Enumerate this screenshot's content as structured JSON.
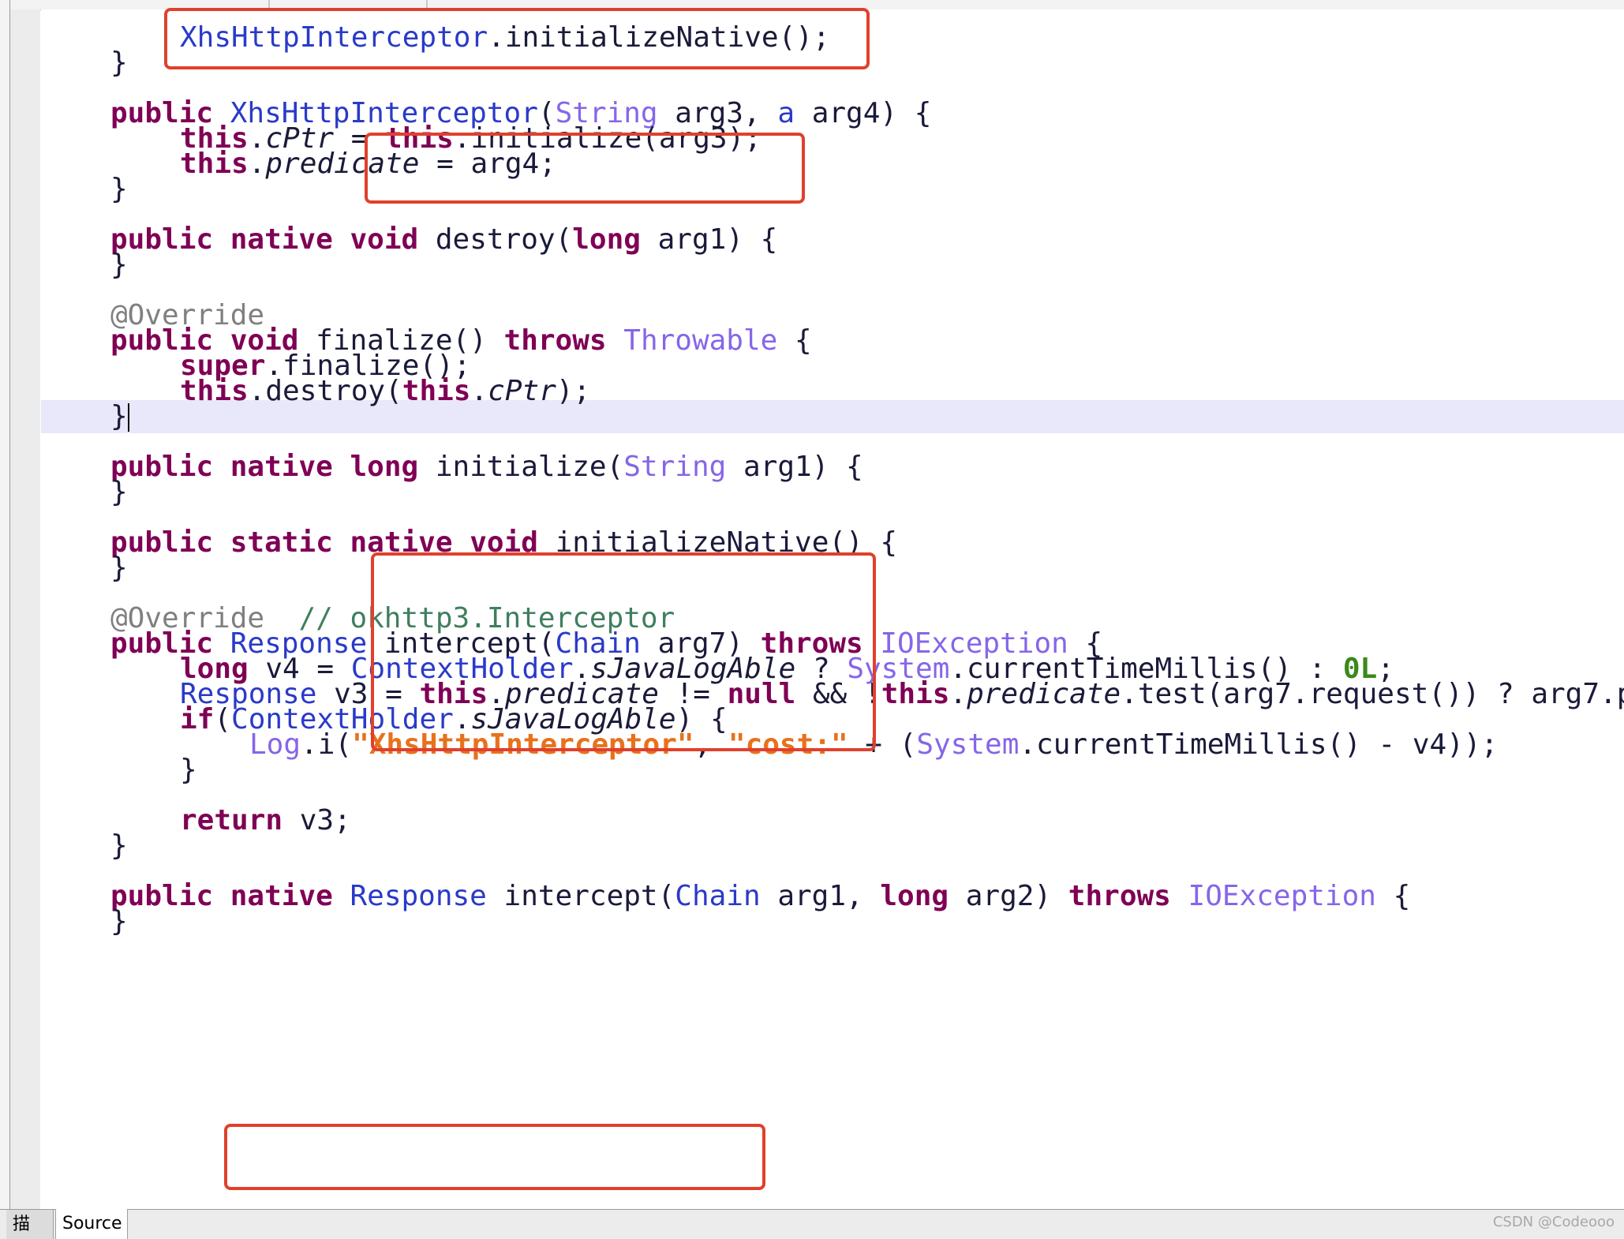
{
  "editor": {
    "lines": [
      {
        "indent": 2,
        "tokens": [
          {
            "t": "XhsHttpInterceptor",
            "c": "ty"
          },
          {
            "t": ".initializeNative();"
          }
        ]
      },
      {
        "indent": 1,
        "tokens": [
          {
            "t": "}"
          }
        ]
      },
      {
        "indent": 0,
        "tokens": []
      },
      {
        "indent": 1,
        "tokens": [
          {
            "t": "public",
            "c": "kw"
          },
          {
            "t": " "
          },
          {
            "t": "XhsHttpInterceptor",
            "c": "ty"
          },
          {
            "t": "("
          },
          {
            "t": "String",
            "c": "ty2"
          },
          {
            "t": " arg3, "
          },
          {
            "t": "a",
            "c": "ty"
          },
          {
            "t": " arg4) {"
          }
        ]
      },
      {
        "indent": 2,
        "tokens": [
          {
            "t": "this",
            "c": "kw"
          },
          {
            "t": "."
          },
          {
            "t": "cPtr",
            "c": "fld"
          },
          {
            "t": " = "
          },
          {
            "t": "this",
            "c": "kw"
          },
          {
            "t": ".initialize(arg3);"
          }
        ]
      },
      {
        "indent": 2,
        "tokens": [
          {
            "t": "this",
            "c": "kw"
          },
          {
            "t": "."
          },
          {
            "t": "predicate",
            "c": "fld"
          },
          {
            "t": " = arg4;"
          }
        ]
      },
      {
        "indent": 1,
        "tokens": [
          {
            "t": "}"
          }
        ]
      },
      {
        "indent": 0,
        "tokens": []
      },
      {
        "indent": 1,
        "tokens": [
          {
            "t": "public",
            "c": "kw"
          },
          {
            "t": " "
          },
          {
            "t": "native",
            "c": "kw"
          },
          {
            "t": " "
          },
          {
            "t": "void",
            "c": "kw"
          },
          {
            "t": " destroy("
          },
          {
            "t": "long",
            "c": "kw"
          },
          {
            "t": " arg1) {"
          }
        ]
      },
      {
        "indent": 1,
        "tokens": [
          {
            "t": "}"
          }
        ]
      },
      {
        "indent": 0,
        "tokens": []
      },
      {
        "indent": 1,
        "tokens": [
          {
            "t": "@Override",
            "c": "ann"
          }
        ]
      },
      {
        "indent": 1,
        "tokens": [
          {
            "t": "public",
            "c": "kw"
          },
          {
            "t": " "
          },
          {
            "t": "void",
            "c": "kw"
          },
          {
            "t": " finalize() "
          },
          {
            "t": "throws",
            "c": "kw"
          },
          {
            "t": " "
          },
          {
            "t": "Throwable",
            "c": "ty2"
          },
          {
            "t": " {"
          }
        ]
      },
      {
        "indent": 2,
        "tokens": [
          {
            "t": "super",
            "c": "kw"
          },
          {
            "t": ".finalize();"
          }
        ]
      },
      {
        "indent": 2,
        "tokens": [
          {
            "t": "this",
            "c": "kw"
          },
          {
            "t": ".destroy("
          },
          {
            "t": "this",
            "c": "kw"
          },
          {
            "t": "."
          },
          {
            "t": "cPtr",
            "c": "fld"
          },
          {
            "t": ");"
          }
        ]
      },
      {
        "indent": 1,
        "tokens": [
          {
            "t": "}"
          },
          {
            "t": "",
            "c": "caret"
          }
        ]
      },
      {
        "indent": 0,
        "tokens": []
      },
      {
        "indent": 1,
        "tokens": [
          {
            "t": "public",
            "c": "kw"
          },
          {
            "t": " "
          },
          {
            "t": "native",
            "c": "kw"
          },
          {
            "t": " "
          },
          {
            "t": "long",
            "c": "kw"
          },
          {
            "t": " initialize("
          },
          {
            "t": "String",
            "c": "ty2"
          },
          {
            "t": " arg1) {"
          }
        ]
      },
      {
        "indent": 1,
        "tokens": [
          {
            "t": "}"
          }
        ]
      },
      {
        "indent": 0,
        "tokens": []
      },
      {
        "indent": 1,
        "tokens": [
          {
            "t": "public",
            "c": "kw"
          },
          {
            "t": " "
          },
          {
            "t": "static",
            "c": "kw"
          },
          {
            "t": " "
          },
          {
            "t": "native",
            "c": "kw"
          },
          {
            "t": " "
          },
          {
            "t": "void",
            "c": "kw"
          },
          {
            "t": " initializeNative() {"
          }
        ]
      },
      {
        "indent": 1,
        "tokens": [
          {
            "t": "}"
          }
        ]
      },
      {
        "indent": 0,
        "tokens": []
      },
      {
        "indent": 1,
        "tokens": [
          {
            "t": "@Override",
            "c": "ann"
          },
          {
            "t": "  "
          },
          {
            "t": "// okhttp3.Interceptor",
            "c": "cmt"
          }
        ]
      },
      {
        "indent": 1,
        "tokens": [
          {
            "t": "public",
            "c": "kw"
          },
          {
            "t": " "
          },
          {
            "t": "Response",
            "c": "ty"
          },
          {
            "t": " intercept("
          },
          {
            "t": "Chain",
            "c": "ty"
          },
          {
            "t": " arg7) "
          },
          {
            "t": "throws",
            "c": "kw"
          },
          {
            "t": " "
          },
          {
            "t": "IOException",
            "c": "ty2"
          },
          {
            "t": " {"
          }
        ]
      },
      {
        "indent": 2,
        "tokens": [
          {
            "t": "long",
            "c": "kw"
          },
          {
            "t": " v4 = "
          },
          {
            "t": "ContextHolder",
            "c": "ty"
          },
          {
            "t": "."
          },
          {
            "t": "sJavaLogAble",
            "c": "fld"
          },
          {
            "t": " ? "
          },
          {
            "t": "System",
            "c": "ty2"
          },
          {
            "t": ".currentTimeMillis() : "
          },
          {
            "t": "0L",
            "c": "num"
          },
          {
            "t": ";"
          }
        ]
      },
      {
        "indent": 2,
        "tokens": [
          {
            "t": "Response",
            "c": "ty"
          },
          {
            "t": " v3 = "
          },
          {
            "t": "this",
            "c": "kw"
          },
          {
            "t": "."
          },
          {
            "t": "predicate",
            "c": "fld"
          },
          {
            "t": " != "
          },
          {
            "t": "null",
            "c": "kw"
          },
          {
            "t": " && !"
          },
          {
            "t": "this",
            "c": "kw"
          },
          {
            "t": "."
          },
          {
            "t": "predicate",
            "c": "fld"
          },
          {
            "t": ".test(arg7.request()) ? arg7.p"
          }
        ]
      },
      {
        "indent": 2,
        "tokens": [
          {
            "t": "if",
            "c": "kw"
          },
          {
            "t": "("
          },
          {
            "t": "ContextHolder",
            "c": "ty"
          },
          {
            "t": "."
          },
          {
            "t": "sJavaLogAble",
            "c": "fld"
          },
          {
            "t": ") {"
          }
        ]
      },
      {
        "indent": 3,
        "tokens": [
          {
            "t": "Log",
            "c": "ty2"
          },
          {
            "t": ".i("
          },
          {
            "t": "\"XhsHttpInterceptor\"",
            "c": "str"
          },
          {
            "t": ", "
          },
          {
            "t": "\"cost:\"",
            "c": "str"
          },
          {
            "t": " + ("
          },
          {
            "t": "System",
            "c": "ty2"
          },
          {
            "t": ".currentTimeMillis() - v4));"
          }
        ]
      },
      {
        "indent": 2,
        "tokens": [
          {
            "t": "}"
          }
        ]
      },
      {
        "indent": 0,
        "tokens": []
      },
      {
        "indent": 2,
        "tokens": [
          {
            "t": "return",
            "c": "kw"
          },
          {
            "t": " v3;"
          }
        ]
      },
      {
        "indent": 1,
        "tokens": [
          {
            "t": "}"
          }
        ]
      },
      {
        "indent": 0,
        "tokens": []
      },
      {
        "indent": 1,
        "tokens": [
          {
            "t": "public",
            "c": "kw"
          },
          {
            "t": " "
          },
          {
            "t": "native",
            "c": "kw"
          },
          {
            "t": " "
          },
          {
            "t": "Response",
            "c": "ty"
          },
          {
            "t": " intercept("
          },
          {
            "t": "Chain",
            "c": "ty"
          },
          {
            "t": " arg1, "
          },
          {
            "t": "long",
            "c": "kw"
          },
          {
            "t": " arg2) "
          },
          {
            "t": "throws",
            "c": "kw"
          },
          {
            "t": " "
          },
          {
            "t": "IOException",
            "c": "ty2"
          },
          {
            "t": " {"
          }
        ]
      },
      {
        "indent": 1,
        "tokens": [
          {
            "t": "}"
          }
        ]
      }
    ],
    "current_line": 15,
    "highlight_color": "#e0402c"
  },
  "bottom_tabs": [
    {
      "label": "描述"
    },
    {
      "label": "Source",
      "active": true
    }
  ],
  "watermark": "CSDN @Codeooo"
}
